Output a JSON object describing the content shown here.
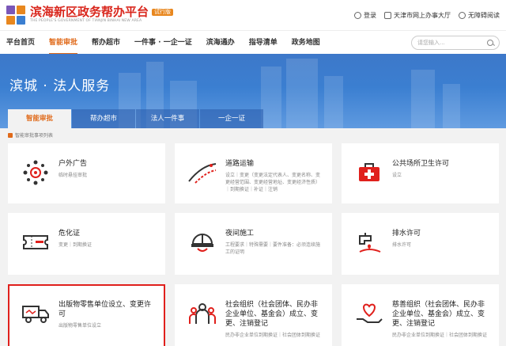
{
  "header": {
    "title": "滨海新区政务帮办平台",
    "badge": "试行版",
    "subtitle": "THE PEOPLE'S GOVERNMENT OF TIANJIN BINHAI NEW AREA",
    "links": [
      "登录",
      "天津市网上办事大厅",
      "无障碍阅读"
    ]
  },
  "nav": {
    "items": [
      "平台首页",
      "智能审批",
      "帮办超市",
      "一件事 · 一企一证",
      "滨海通办",
      "指导清单",
      "政务地图"
    ],
    "active_index": 1,
    "search_placeholder": "请您输入..."
  },
  "banner": {
    "title": "滨城 · 法人服务",
    "tabs": [
      "智能审批",
      "帮办超市",
      "法人一件事",
      "一企一证"
    ],
    "active_tab": 0
  },
  "breadcrumb": "智能审批事项列表",
  "cards": [
    {
      "title": "户外广告",
      "desc": "临时悬挂审批"
    },
    {
      "title": "道路运输",
      "desc": "设立｜变更（变更法定代表人、变更名称、变更经营范围、变更经营地址、变更经济性质）｜到期换证｜补证｜注销"
    },
    {
      "title": "公共场所卫生许可",
      "desc": "设立"
    },
    {
      "title": "危化证",
      "desc": "变更｜到期换证"
    },
    {
      "title": "夜间施工",
      "desc": "工程要求｜特殊需要｜要件准备：必须连续施工的证明"
    },
    {
      "title": "排水许可",
      "desc": "排水许可"
    },
    {
      "title": "出版物零售单位设立、变更许可",
      "desc": "出版物零售单位设立"
    },
    {
      "title": "社会组织（社会团体、民办非企业单位、基金会）成立、变更、注销登记",
      "desc": "民办非企业单位到期换证｜社会团体到期换证"
    },
    {
      "title": "慈善组织（社会团体、民办非企业单位、基金会）成立、变更、注销登记",
      "desc": "民办非企业单位到期换证｜社会团体到期换证"
    }
  ],
  "colors": {
    "accent": "#e06a1a",
    "brand_red": "#d9261c",
    "banner_blue": "#3b7fd1",
    "icon_red": "#e0201c"
  }
}
